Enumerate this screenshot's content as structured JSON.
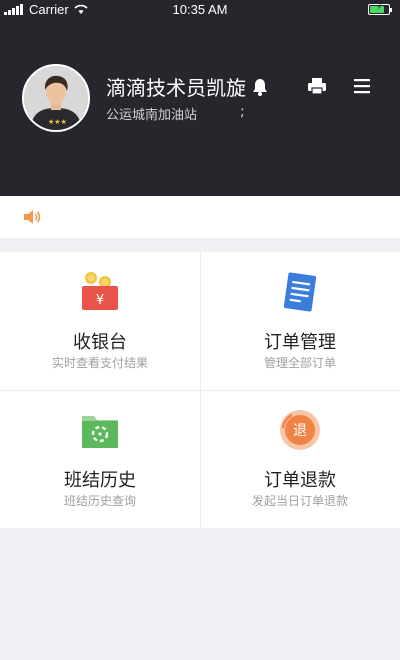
{
  "status_bar": {
    "carrier": "Carrier",
    "time": "10:35 AM",
    "battery_level": 0.75,
    "battery_color": "#4cd964"
  },
  "profile": {
    "name": "滴滴技术员凯旋",
    "station": "公运城南加油站",
    "extra_mark": ";"
  },
  "header_icons": [
    "bell-icon",
    "printer-icon",
    "menu-icon"
  ],
  "notice": {
    "icon": "speaker-icon",
    "text": ""
  },
  "tiles": [
    {
      "title": "收银台",
      "subtitle": "实时查看支付结果",
      "icon": "cashier-icon"
    },
    {
      "title": "订单管理",
      "subtitle": "管理全部订单",
      "icon": "order-doc-icon"
    },
    {
      "title": "班结历史",
      "subtitle": "班结历史查询",
      "icon": "shift-history-icon"
    },
    {
      "title": "订单退款",
      "subtitle": "发起当日订单退款",
      "icon": "refund-icon"
    }
  ],
  "colors": {
    "header_bg": "#25272c",
    "page_bg": "#f0f1f5",
    "accent_orange": "#f39a4d",
    "cashier_red": "#e9544a",
    "order_blue": "#3b7ddd",
    "history_green": "#5cb85c"
  }
}
